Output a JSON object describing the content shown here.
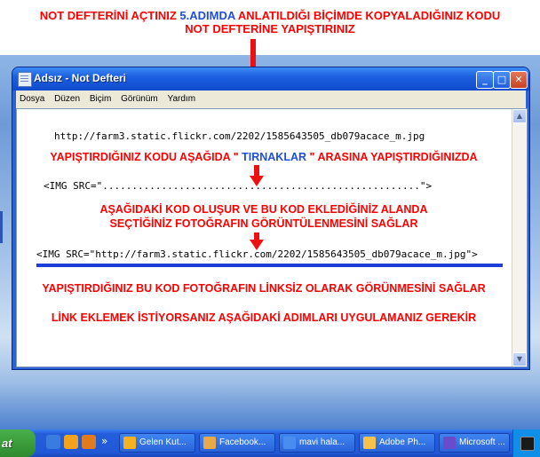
{
  "headline": {
    "line1_part1": "NOT DEFTERİNİ AÇTINIZ",
    "line1_step": "5.ADIMDA",
    "line1_part2": "ANLATILDIĞI BİÇİMDE KOPYALADIĞINIZ KODU",
    "line2": "NOT DEFTERİNE YAPIŞTIRINIZ"
  },
  "window": {
    "title": "Adsız - Not Defteri",
    "buttons": {
      "minimize": "_",
      "maximize": "□",
      "close": "✕"
    }
  },
  "menu": [
    "Dosya",
    "Düzen",
    "Biçim",
    "Görünüm",
    "Yardım"
  ],
  "editor": {
    "url_line": "http://farm3.static.flickr.com/2202/1585643505_db079acace_m.jpg",
    "instruction1_part1": "YAPIŞTIRDIĞINIZ KODU AŞAĞIDA \"",
    "instruction1_highlight": "TIRNAKLAR",
    "instruction1_part2": "\" ARASINA YAPIŞTIRDIĞINIZDA",
    "img_template": "<IMG SRC=\"......................................................\">",
    "instruction2_line1": "AŞAĞIDAKİ KOD OLUŞUR VE BU KOD EKLEDİĞİNİZ ALANDA",
    "instruction2_line2": "SEÇTİĞİNİZ FOTOĞRAFIN GÖRÜNTÜLENMESİNİ SAĞLAR",
    "img_result": "<IMG SRC=\"http://farm3.static.flickr.com/2202/1585643505_db079acace_m.jpg\">",
    "note1": "YAPIŞTIRDIĞINIZ BU KOD FOTOĞRAFIN LİNKSİZ OLARAK GÖRÜNMESİNİ SAĞLAR",
    "note2": "LİNK EKLEMEK İSTİYORSANIZ AŞAĞIDAKİ ADIMLARI UYGULAMANIZ GEREKİR"
  },
  "taskbar": {
    "start_label": "at",
    "tasks": [
      "Gelen Kut...",
      "Facebook...",
      "mavi hala...",
      "Adobe Ph...",
      "Microsoft ..."
    ],
    "overflow": "»"
  },
  "colors": {
    "instruction_red": "#ff0000",
    "highlight_blue": "#1f4ed8",
    "divider_blue": "#1b3fd6",
    "xp_title_blue": "#0e4ccc"
  }
}
